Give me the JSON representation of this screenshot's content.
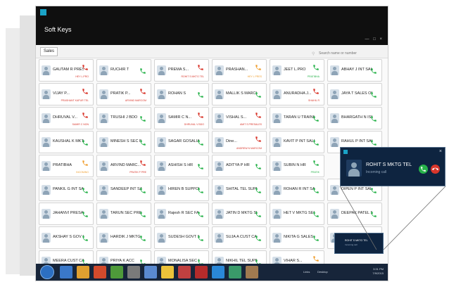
{
  "app": {
    "title": "Soft Keys"
  },
  "search": {
    "placeholder": "Search name or number"
  },
  "tabs": [
    {
      "label": "Sales"
    }
  ],
  "colors": {
    "call_green": "#27b24a",
    "call_red": "#d9362b",
    "missed_orange": "#f0a033",
    "popup_bg": "#0e2440"
  },
  "contacts": [
    [
      {
        "name": "GAUTAM R PRES...",
        "status": "HEY L.PRO",
        "call": "red"
      },
      {
        "name": "RUCHIR T",
        "status": "",
        "call": "green"
      },
      {
        "name": "PREMA S...",
        "status": "ROHIT S MKTG TEL",
        "call": "red"
      },
      {
        "name": "PRASHAN...",
        "status": "HEY L PRES",
        "call": "orange"
      },
      {
        "name": "JEET L.PRO",
        "status": "PRATIBHA",
        "call": "green"
      },
      {
        "name": "ABHAY J INT SALES",
        "status": "",
        "call": "green"
      }
    ],
    [
      {
        "name": "VIJAY P...",
        "status": "PRASHANT KAPUR TEL",
        "call": "red"
      },
      {
        "name": "PRATIK P...",
        "status": "ARVIND MARCOM",
        "call": "red"
      },
      {
        "name": "ROHAN S",
        "status": "",
        "call": "green"
      },
      {
        "name": "MALLIK S MARCOM",
        "status": "",
        "call": "green"
      },
      {
        "name": "ANURADHA J...",
        "status": "SHAHIL R",
        "call": "red"
      },
      {
        "name": "JAYA T SALES ORR",
        "status": "",
        "call": "green"
      }
    ],
    [
      {
        "name": "DHRUVAL V...",
        "status": "SAMIR C NON",
        "call": "red"
      },
      {
        "name": "TRUSHI J BDO",
        "status": "",
        "call": "green"
      },
      {
        "name": "SAMIR C N...",
        "status": "DHRUVAL V BDO",
        "call": "red"
      },
      {
        "name": "VISHAL S...",
        "status": "AMIT S PRESALES",
        "call": "red"
      },
      {
        "name": "TARAN U TRAINING",
        "status": "",
        "call": "green"
      },
      {
        "name": "BHARGATH N ISEN",
        "status": "",
        "call": "green"
      }
    ],
    [
      {
        "name": "KAUSHAL K MKTG SEC",
        "status": "",
        "call": "green"
      },
      {
        "name": "MINESH S SEC FAE",
        "status": "",
        "call": "green"
      },
      {
        "name": "SAGAR GOSALIA",
        "status": "",
        "call": "green"
      },
      {
        "name": "Dine...",
        "status": "ANDREW N MARCOM",
        "call": "red"
      },
      {
        "name": "KAVIT P INT SALES",
        "status": "",
        "call": "green"
      },
      {
        "name": "RAHUL P INT SALES",
        "status": "",
        "call": "green"
      }
    ],
    [
      {
        "name": "PRATIBHA",
        "status": "INCOMING",
        "call": "orange"
      },
      {
        "name": "ARVIND MARC...",
        "status": "PRATIK P PRE",
        "call": "red"
      },
      {
        "name": "ASHISH S HR",
        "status": "",
        "call": "green"
      },
      {
        "name": "ADITYA P HR",
        "status": "",
        "call": "green"
      },
      {
        "name": "SUBIN N HR",
        "status": "PRATIK",
        "call": "green"
      },
      {
        "name": "",
        "status": "",
        "call": "none"
      }
    ],
    [
      {
        "name": "PANKIL G INT SALES",
        "status": "",
        "call": "green"
      },
      {
        "name": "SANDEEP INT SALES",
        "status": "",
        "call": "green"
      },
      {
        "name": "HIREN B SUPPORT",
        "status": "",
        "call": "green"
      },
      {
        "name": "SHITAL TEL SUPPORT",
        "status": "",
        "call": "green"
      },
      {
        "name": "ROHAN R INT SALES",
        "status": "",
        "call": "green"
      },
      {
        "name": "DIPEN P INT SALES",
        "status": "",
        "call": "green"
      }
    ],
    [
      {
        "name": "JAHANVI PRESALES",
        "status": "",
        "call": "green"
      },
      {
        "name": "TARUN SEC PRESALES",
        "status": "",
        "call": "green"
      },
      {
        "name": "Rajesh R SEC FAE",
        "status": "",
        "call": "green"
      },
      {
        "name": "JATIN D MKTG SEC",
        "status": "",
        "call": "green"
      },
      {
        "name": "HET V MKTG SEC",
        "status": "",
        "call": "green"
      },
      {
        "name": "DEEPAK PATEL SEC",
        "status": "",
        "call": "green"
      }
    ],
    [
      {
        "name": "AKSHAY S GOV SALES",
        "status": "",
        "call": "green"
      },
      {
        "name": "HARDIK J MKTG SEC",
        "status": "",
        "call": "green"
      },
      {
        "name": "SUDESH GOVT SALES",
        "status": "",
        "call": "green"
      },
      {
        "name": "SUJA A CUST CARE",
        "status": "",
        "call": "green"
      },
      {
        "name": "NIKITA G SALES ORR",
        "status": "",
        "call": "green"
      },
      {
        "name": "POOJA J BDO",
        "status": "",
        "call": "green"
      }
    ],
    [
      {
        "name": "MEERA CUST CARE",
        "status": "",
        "call": "green"
      },
      {
        "name": "PRIYA K ACC",
        "status": "",
        "call": "green"
      },
      {
        "name": "MONALISA SEC SUPP",
        "status": "",
        "call": "green"
      },
      {
        "name": "NIKHIL TEL SUPPORT",
        "status": "",
        "call": "green"
      },
      {
        "name": "VIHAR S...",
        "status": "HEY L PRO",
        "call": "orange"
      },
      {
        "name": "",
        "status": "",
        "call": "none"
      }
    ]
  ],
  "taskbar": {
    "icons": [
      "windows-start-icon",
      "browser-icon",
      "player-icon",
      "chrome-icon",
      "folder-icon",
      "paint-icon",
      "notepad-icon",
      "power-icon",
      "app-icon",
      "acrobat-icon",
      "skype-icon",
      "softkeys-icon",
      "tools-icon"
    ],
    "tray": [
      "Links",
      "Desktop"
    ],
    "time": "3:31 PM",
    "date": "7/9/2015"
  },
  "call_popup": {
    "caller": "ROHIT S MKTG TEL",
    "status": "Incoming call"
  }
}
